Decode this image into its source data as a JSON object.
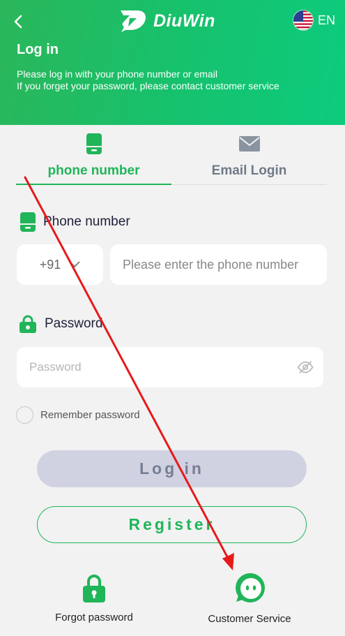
{
  "header": {
    "brand": "DiuWin",
    "language": "EN",
    "title": "Log in",
    "hint_line1": "Please log in with your phone number or email",
    "hint_line2": "If you forget your password, please contact customer service"
  },
  "tabs": [
    {
      "label": "phone number",
      "icon": "phone-icon",
      "active": true
    },
    {
      "label": "Email Login",
      "icon": "mail-icon",
      "active": false
    }
  ],
  "phone_field": {
    "label": "Phone number",
    "country_code": "+91",
    "placeholder": "Please enter the phone number"
  },
  "password_field": {
    "label": "Password",
    "placeholder": "Password"
  },
  "remember_label": "Remember password",
  "buttons": {
    "login": "Log in",
    "register": "Register"
  },
  "bottom_links": {
    "forgot": "Forgot password",
    "customer_service": "Customer Service"
  },
  "colors": {
    "brand_green": "#20b559",
    "header_gradient_start": "#2bb65a",
    "header_gradient_end": "#0ccb7d",
    "login_button_bg": "#d1d2e1",
    "annotation_arrow": "#e8191b"
  }
}
